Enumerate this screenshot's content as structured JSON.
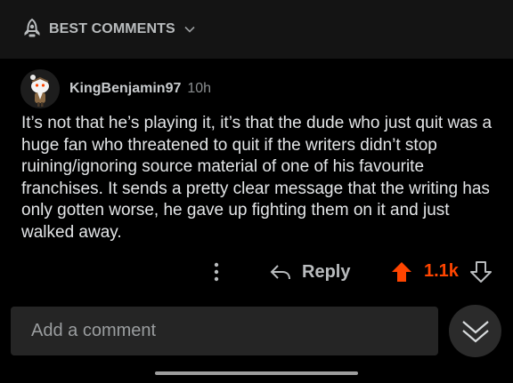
{
  "sort": {
    "label": "BEST COMMENTS",
    "icon": "rocket-icon"
  },
  "comment": {
    "username": "KingBenjamin97",
    "age": "10h",
    "body": "It’s not that he’s playing it, it’s that the dude who just quit was a huge fan who threatened to quit if the writers didn’t stop ruining/ignoring source material of one of his favourite franchises. It sends a pretty clear message that the writing has only gotten worse, he gave up fighting them on it and just walked away.",
    "reply_label": "Reply",
    "score": "1.1k",
    "upvoted": true
  },
  "composer": {
    "placeholder": "Add a comment"
  },
  "colors": {
    "background": "#000000",
    "header": "#141414",
    "upvote": "#ff4500",
    "composer": "#252525"
  }
}
